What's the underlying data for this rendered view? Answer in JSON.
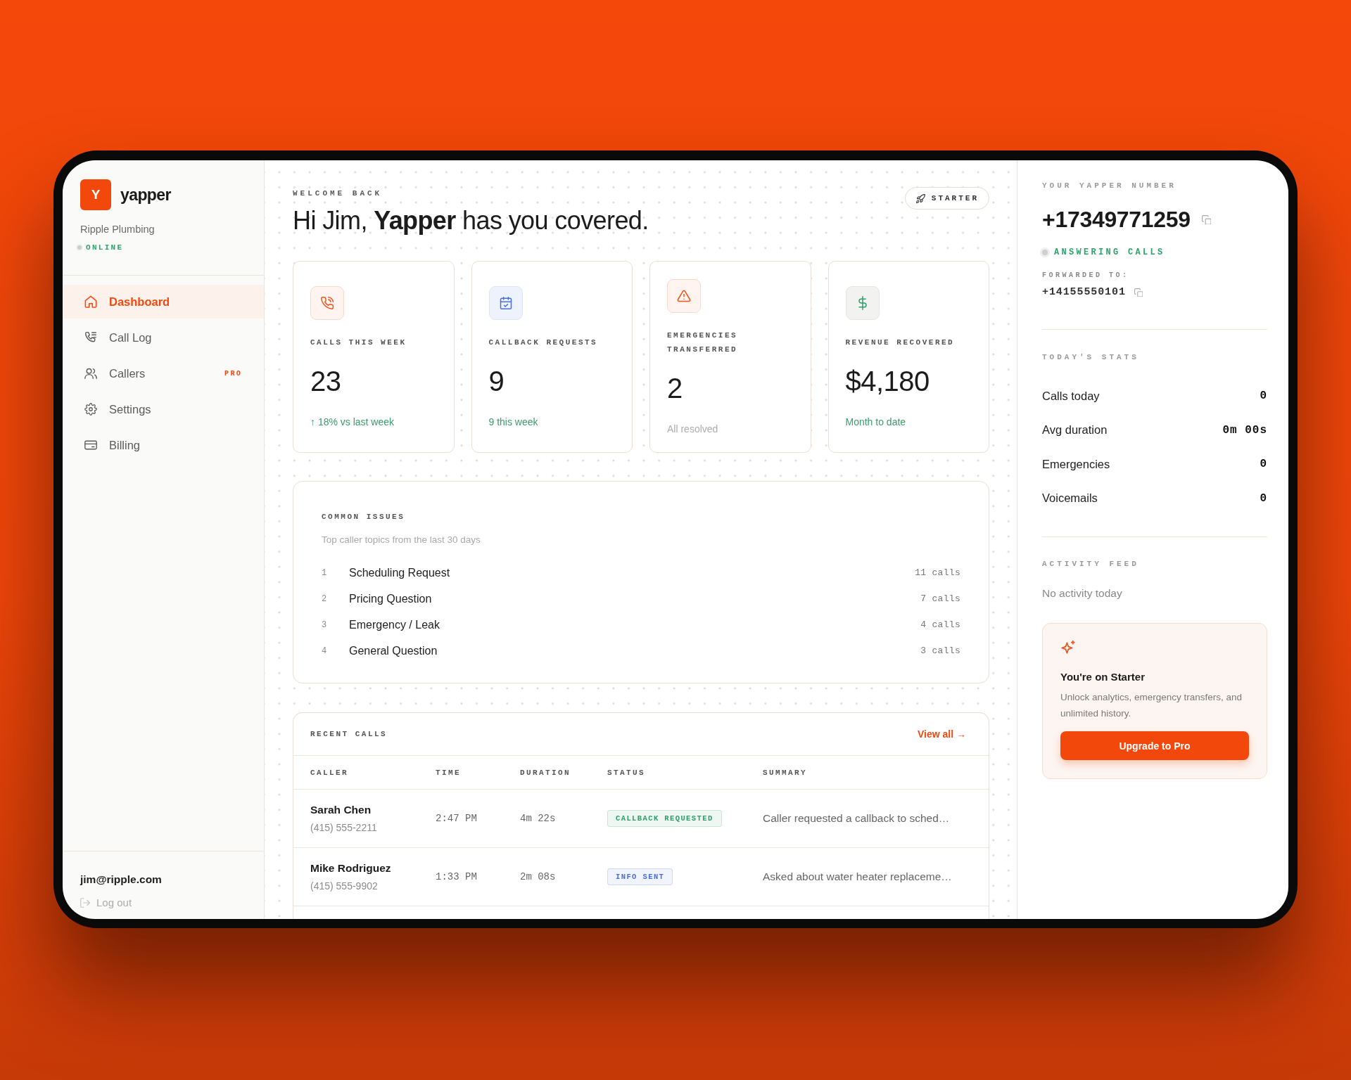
{
  "sidebar": {
    "logo_letter": "Y",
    "brand": "yapper",
    "company": "Ripple Plumbing",
    "status": "ONLINE",
    "nav": [
      {
        "label": "Dashboard",
        "selected": true
      },
      {
        "label": "Call Log",
        "selected": false
      },
      {
        "label": "Callers",
        "selected": false,
        "badge": "PRO"
      },
      {
        "label": "Settings",
        "selected": false
      },
      {
        "label": "Billing",
        "selected": false
      }
    ],
    "user_email": "jim@ripple.com",
    "logout": "Log out"
  },
  "header": {
    "eyebrow": "WELCOME BACK",
    "greeting": "Hi Jim, **Yapper** has you covered.",
    "plan_badge": "STARTER"
  },
  "stat_cards": [
    {
      "label": "CALLS THIS WEEK",
      "value": "23",
      "note": "↑ 18% vs last week",
      "muted": false
    },
    {
      "label": "CALLBACK REQUESTS",
      "value": "9",
      "note": "9 this week",
      "muted": false
    },
    {
      "label": "EMERGENCIES TRANSFERRED",
      "value": "2",
      "note": "All resolved",
      "muted": true
    },
    {
      "label": "REVENUE RECOVERED",
      "value": "$4,180",
      "note": "Month to date",
      "muted": false
    }
  ],
  "common_issues": {
    "title": "COMMON ISSUES",
    "subtitle": "Top caller topics from the last 30 days",
    "items": [
      {
        "rank": "1",
        "topic": "Scheduling Request",
        "count": "11 calls"
      },
      {
        "rank": "2",
        "topic": "Pricing Question",
        "count": "7 calls"
      },
      {
        "rank": "3",
        "topic": "Emergency / Leak",
        "count": "4 calls"
      },
      {
        "rank": "4",
        "topic": "General Question",
        "count": "3 calls"
      }
    ]
  },
  "recent_calls": {
    "title": "RECENT CALLS",
    "view_all": "View all →",
    "columns": [
      "CALLER",
      "TIME",
      "DURATION",
      "STATUS",
      "SUMMARY"
    ],
    "rows": [
      {
        "caller": "Sarah Chen",
        "phone": "(415) 555-2211",
        "time": "2:47 PM",
        "duration": "4m 22s",
        "status": {
          "label": "CALLBACK REQUESTED",
          "color": "#2f9e6b"
        },
        "summary": "Caller requested a callback to sched…"
      },
      {
        "caller": "Mike Rodriguez",
        "phone": "(415) 555-9902",
        "time": "1:33 PM",
        "duration": "2m 08s",
        "status": {
          "label": "INFO SENT",
          "color": "#4a6fdc"
        },
        "summary": "Asked about water heater replaceme…"
      }
    ]
  },
  "right_panel": {
    "number_label": "YOUR YAPPER NUMBER",
    "number": "+17349771259",
    "line_status": "ANSWERING CALLS",
    "forwarded_label": "FORWARDED TO:",
    "forwarded_number": "+14155550101",
    "stats_title": "TODAY'S STATS",
    "stats": [
      {
        "label": "Calls today",
        "value": "0"
      },
      {
        "label": "Avg duration",
        "value": "0m 00s"
      },
      {
        "label": "Emergencies",
        "value": "0"
      },
      {
        "label": "Voicemails",
        "value": "0"
      }
    ],
    "activity_title": "ACTIVITY FEED",
    "activity_empty": "No activity today",
    "upgrade": {
      "title": "You're on Starter",
      "text": "Unlock analytics, emergency transfers, and unlimited history.",
      "button": "Upgrade to Pro"
    }
  }
}
